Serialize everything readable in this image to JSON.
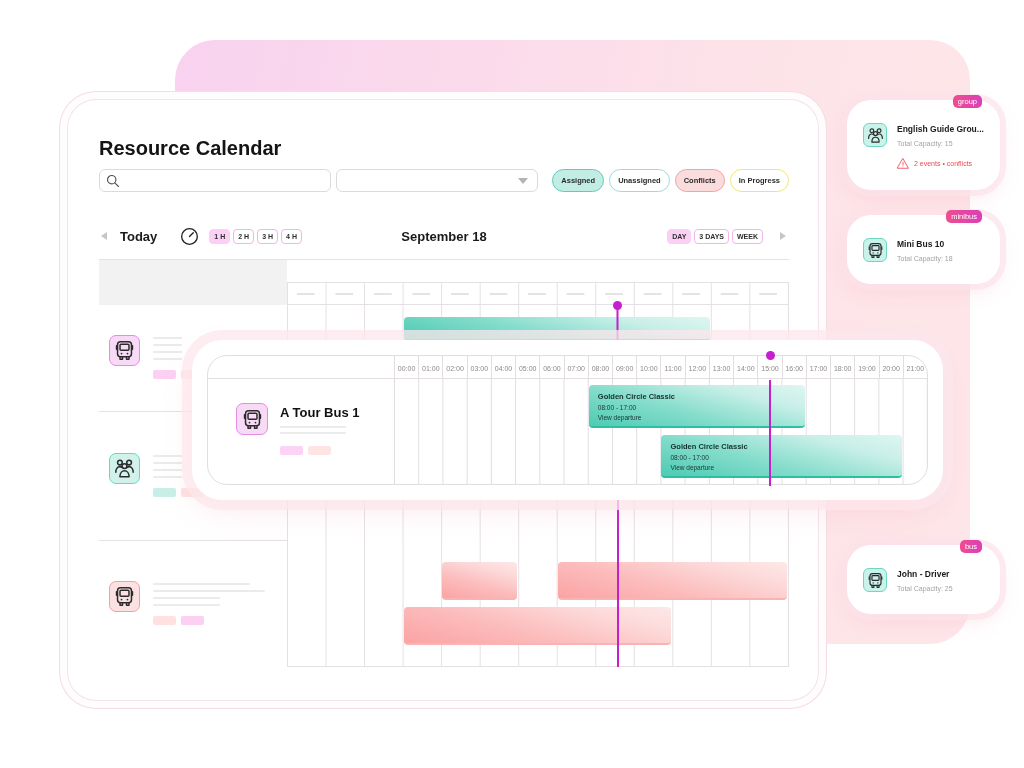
{
  "title": "Resource Calendar",
  "filters": [
    {
      "label": "Assigned",
      "color": "#5ccfb8",
      "selected": true
    },
    {
      "label": "Unassigned",
      "color": "#86e3ee",
      "selected": false
    },
    {
      "label": "Conflicts",
      "color": "#f5a2a2",
      "selected": true
    },
    {
      "label": "In Progress",
      "color": "#f1e37c",
      "selected": false
    }
  ],
  "toolbar": {
    "today": "Today",
    "zoom_levels": [
      {
        "label": "1 H",
        "selected": true
      },
      {
        "label": "2 H",
        "selected": false
      },
      {
        "label": "3 H",
        "selected": false
      },
      {
        "label": "4 H",
        "selected": false
      }
    ],
    "date": "September 18",
    "views": [
      {
        "label": "DAY",
        "selected": true
      },
      {
        "label": "3 DAYS",
        "selected": false
      },
      {
        "label": "WEEK",
        "selected": false
      }
    ]
  },
  "resources": [
    {
      "kind": "bus",
      "color": "#e58be0",
      "tags": [
        {
          "color": "#fbd0f3"
        },
        {
          "color": "#ffe1e1"
        }
      ],
      "events": [
        {
          "kind": "assigned"
        }
      ]
    },
    {
      "kind": "group",
      "color": "#6dd5c0",
      "tags": [
        {
          "color": "#c8efe7"
        },
        {
          "color": "#ffe1e1"
        }
      ]
    },
    {
      "kind": "bus",
      "color": "#f3a0a0",
      "tags": [
        {
          "color": "#ffe1e1"
        },
        {
          "color": "#fbd0f3"
        }
      ],
      "events": [
        {
          "kind": "conflict"
        },
        {
          "kind": "conflict"
        },
        {
          "kind": "conflict"
        }
      ]
    }
  ],
  "featured_resource": {
    "name": "A Tour Bus 1",
    "kind": "bus",
    "color": "#e58be0",
    "tags": [
      {
        "color": "#fcd3f5"
      },
      {
        "color": "#ffe4e4"
      }
    ],
    "hours": [
      "00:00",
      "01:00",
      "02:00",
      "03:00",
      "04:00",
      "05:00",
      "06:00",
      "07:00",
      "08:00",
      "09:00",
      "10:00",
      "11:00",
      "12:00",
      "13:00",
      "14:00",
      "15:00",
      "16:00",
      "17:00",
      "18:00",
      "19:00",
      "20:00",
      "21:00"
    ],
    "events": [
      {
        "kind": "assigned",
        "title": "Golden Circle Classic",
        "time": "08:00 - 17:00",
        "link": "View departure"
      },
      {
        "kind": "assigned",
        "title": "Golden Circle Classic",
        "time": "08:00 - 17:00",
        "link": "View departure"
      }
    ]
  },
  "resource_cards": [
    {
      "badge": "group",
      "kind": "group",
      "name": "English Guide Grou...",
      "capacity": "Total Capacity: 15",
      "alert": "2 events • conflicts"
    },
    {
      "badge": "minibus",
      "kind": "bus",
      "name": "Mini Bus 10",
      "capacity": "Total Capacity: 18"
    },
    {
      "badge": "bus",
      "kind": "bus",
      "name": "John - Driver",
      "capacity": "Total Capacity: 25"
    }
  ]
}
